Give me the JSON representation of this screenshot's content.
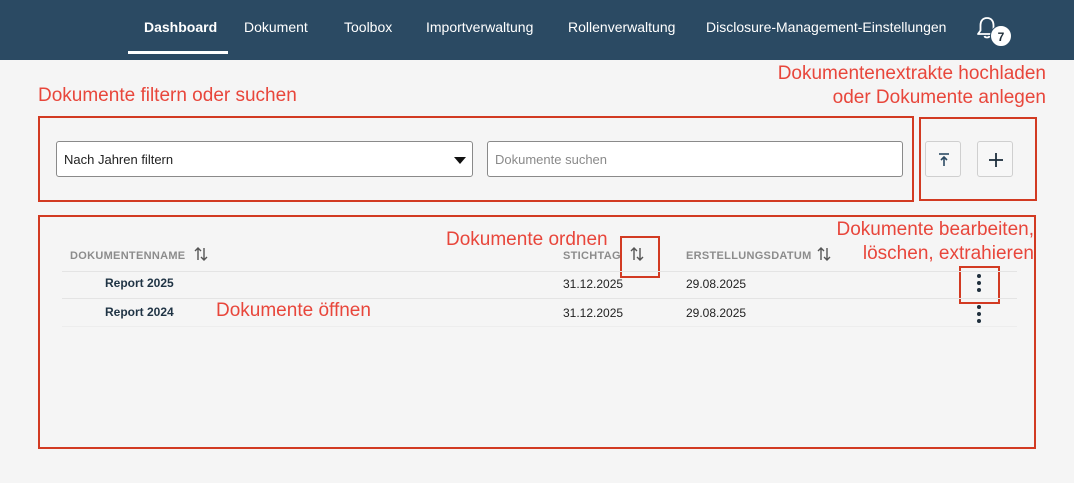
{
  "nav": {
    "items": [
      {
        "label": "Dashboard"
      },
      {
        "label": "Dokument"
      },
      {
        "label": "Toolbox"
      },
      {
        "label": "Importverwaltung"
      },
      {
        "label": "Rollenverwaltung"
      },
      {
        "label": "Disclosure-Management-Einstellungen"
      }
    ],
    "active_item": "Dashboard",
    "notification_count": "7",
    "notification_icon": "bell-icon"
  },
  "annotations": {
    "filter_search": "Dokumente filtern oder suchen",
    "upload_line1": "Dokumentenextrakte hochladen",
    "upload_line2": "oder Dokumente anlegen",
    "sort": "Dokumente ordnen",
    "edit_line1": "Dokumente bearbeiten,",
    "edit_line2": "löschen, extrahieren",
    "open": "Dokumente öffnen",
    "color": "#e8463b"
  },
  "filter": {
    "year_select_value": "Nach Jahren filtern",
    "search_placeholder": "Dokumente suchen",
    "upload_icon": "upload-icon",
    "add_icon": "plus-icon"
  },
  "table": {
    "columns": [
      {
        "label": "DOKUMENTENNAME",
        "sortable": true
      },
      {
        "label": "STICHTAG",
        "sortable": true
      },
      {
        "label": "ERSTELLUNGSDATUM",
        "sortable": true
      }
    ],
    "rows": [
      {
        "name": "Report 2025",
        "stichtag": "31.12.2025",
        "erstellungsdatum": "29.08.2025"
      },
      {
        "name": "Report 2024",
        "stichtag": "31.12.2025",
        "erstellungsdatum": "29.08.2025"
      }
    ],
    "row_action_icon": "more-vertical-icon"
  },
  "colors": {
    "navbar": "#2b4a63",
    "highlight_border": "#d23a22",
    "background": "#f5f5f5"
  }
}
